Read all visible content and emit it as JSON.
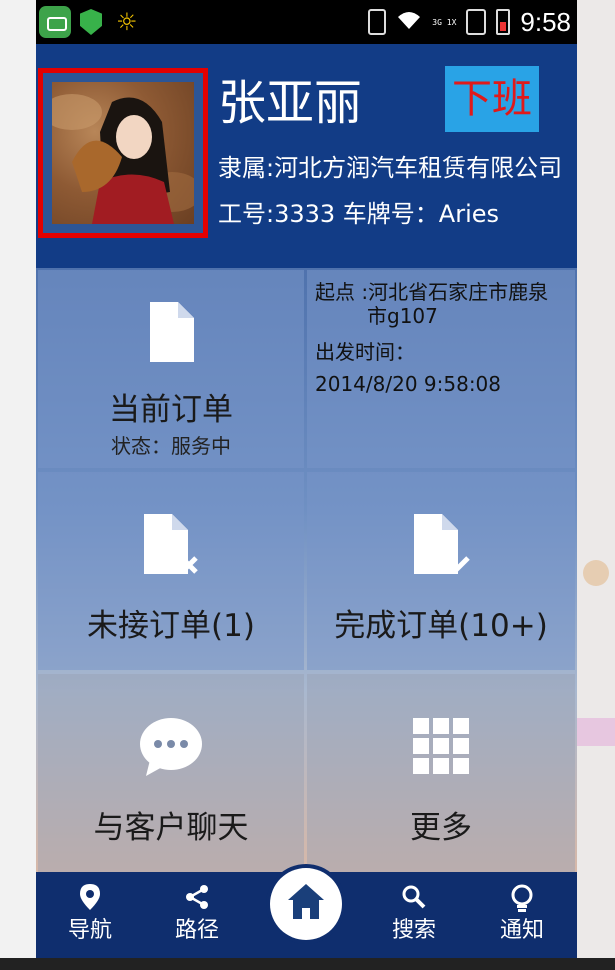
{
  "statusbar": {
    "net_label": "3G 1X",
    "time": "9:58"
  },
  "driver": {
    "name": "张亚丽",
    "company_line": "隶属:河北方润汽车租赁有限公司",
    "id_line": "工号:3333  车牌号：Aries"
  },
  "header": {
    "off_duty_label": "下班"
  },
  "tiles": {
    "current_order": {
      "label": "当前订单",
      "status": "状态：服务中"
    },
    "order_info": {
      "start_label": "起点 :河北省石家庄市鹿泉",
      "start_label_cont": "市g107",
      "depart_label": "出发时间：",
      "depart_time": "2014/8/20 9:58:08"
    },
    "unaccepted": {
      "label": "未接订单(1)"
    },
    "completed": {
      "label": "完成订单(10+)"
    },
    "chat": {
      "label": "与客户聊天"
    },
    "more": {
      "label": "更多"
    }
  },
  "nav": {
    "items": [
      {
        "label": "导航",
        "icon": "location-pin-icon"
      },
      {
        "label": "路径",
        "icon": "share-route-icon"
      },
      {
        "label": "",
        "icon": "home-icon"
      },
      {
        "label": "搜索",
        "icon": "search-icon"
      },
      {
        "label": "通知",
        "icon": "lightbulb-icon"
      }
    ]
  },
  "colors": {
    "primary": "#123c86",
    "accent": "#29a3e6",
    "off_duty_text": "#e01a1a",
    "avatar_highlight": "#e30000"
  }
}
